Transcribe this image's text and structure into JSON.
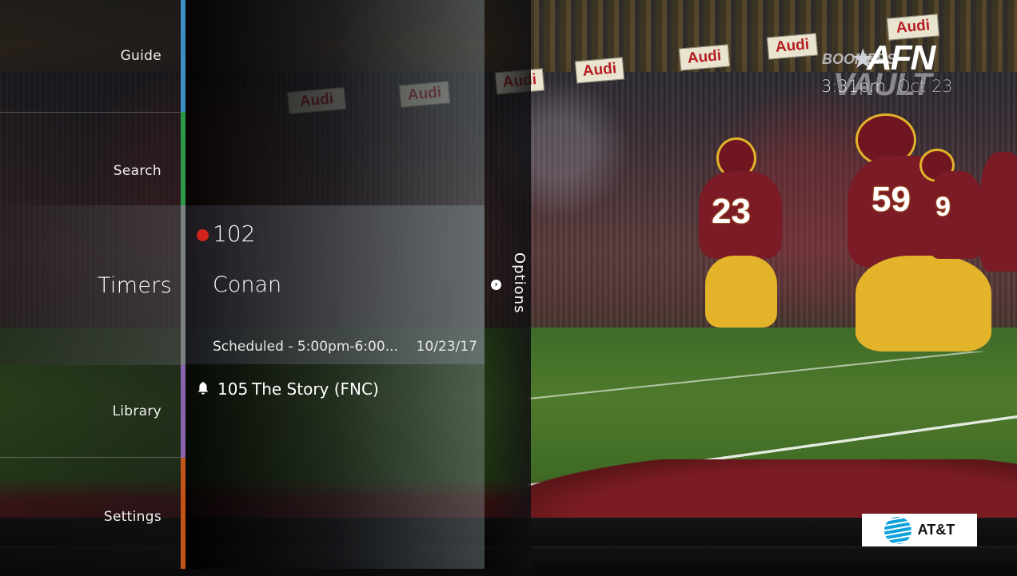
{
  "nav": {
    "items": [
      {
        "label": "Guide",
        "color": "#3d8fc6",
        "active": false
      },
      {
        "label": "Search",
        "color": "#2d9a4a",
        "active": false
      },
      {
        "label": "Timers",
        "color": "#7a8280",
        "active": true
      },
      {
        "label": "Library",
        "color": "#8a63b0",
        "active": false
      },
      {
        "label": "Settings",
        "color": "#c4531a",
        "active": false
      }
    ]
  },
  "timers": {
    "selected": {
      "recording_indicator": "red-dot",
      "channel": "102",
      "title": "Conan",
      "schedule": "Scheduled - 5:00pm-6:00...",
      "date": "10/23/17"
    },
    "items": [
      {
        "icon": "bell-icon",
        "channel": "105",
        "title": "The Story (FNC)"
      }
    ]
  },
  "options": {
    "label": "Options",
    "icon": "chevron-right-circle-icon"
  },
  "overlay": {
    "network_logo": "AFN",
    "program_logo_top": "BOOMERS",
    "program_logo_bottom": "VAULT",
    "time": "3:31pm",
    "date": "Oct 23"
  },
  "scene": {
    "ad_text": "Audi",
    "jersey_numbers": [
      "23",
      "59",
      "9"
    ]
  },
  "sponsor": {
    "label": "AT&T",
    "icon": "att-globe-icon"
  },
  "colors": {
    "recording": "#d0241c",
    "att_blue": "#0ea2db"
  }
}
